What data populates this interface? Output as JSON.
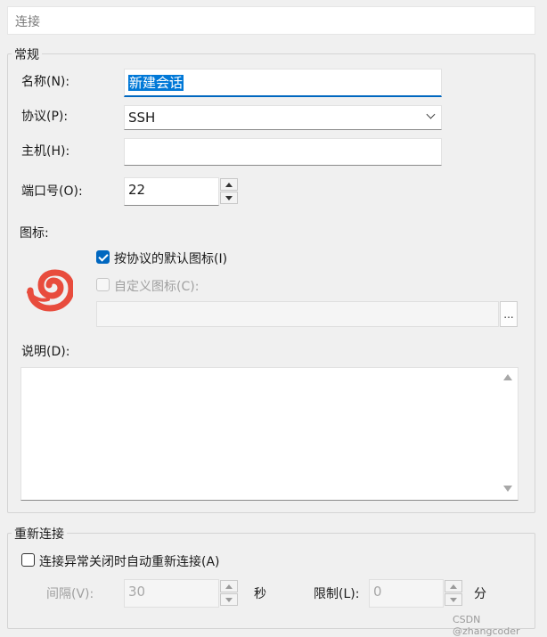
{
  "header": {
    "title": "连接"
  },
  "general": {
    "group_title": "常规",
    "name_label": "名称(N):",
    "name_value": "新建会话",
    "protocol_label": "协议(P):",
    "protocol_value": "SSH",
    "host_label": "主机(H):",
    "host_value": "",
    "port_label": "端口号(O):",
    "port_value": "22",
    "icon_label": "图标:",
    "default_icon_label": "按协议的默认图标(I)",
    "default_icon_checked": true,
    "custom_icon_label": "自定义图标(C):",
    "custom_icon_checked": false,
    "custom_icon_path": "",
    "browse_label": "...",
    "description_label": "说明(D):",
    "description_value": ""
  },
  "reconnect": {
    "group_title": "重新连接",
    "auto_reconnect_label": "连接异常关闭时自动重新连接(A)",
    "auto_reconnect_checked": false,
    "interval_label": "间隔(V):",
    "interval_value": "30",
    "interval_unit": "秒",
    "limit_label": "限制(L):",
    "limit_value": "0",
    "limit_unit": "分"
  },
  "watermark": "CSDN @zhangcoder",
  "icons": {
    "session_icon": "xshell-swirl-icon",
    "dropdown": "chevron-down-icon",
    "spin_up": "spin-up-icon",
    "spin_down": "spin-down-icon"
  },
  "colors": {
    "accent": "#0067c0",
    "selection": "#0078d7",
    "session_icon": "#e84c3d"
  }
}
